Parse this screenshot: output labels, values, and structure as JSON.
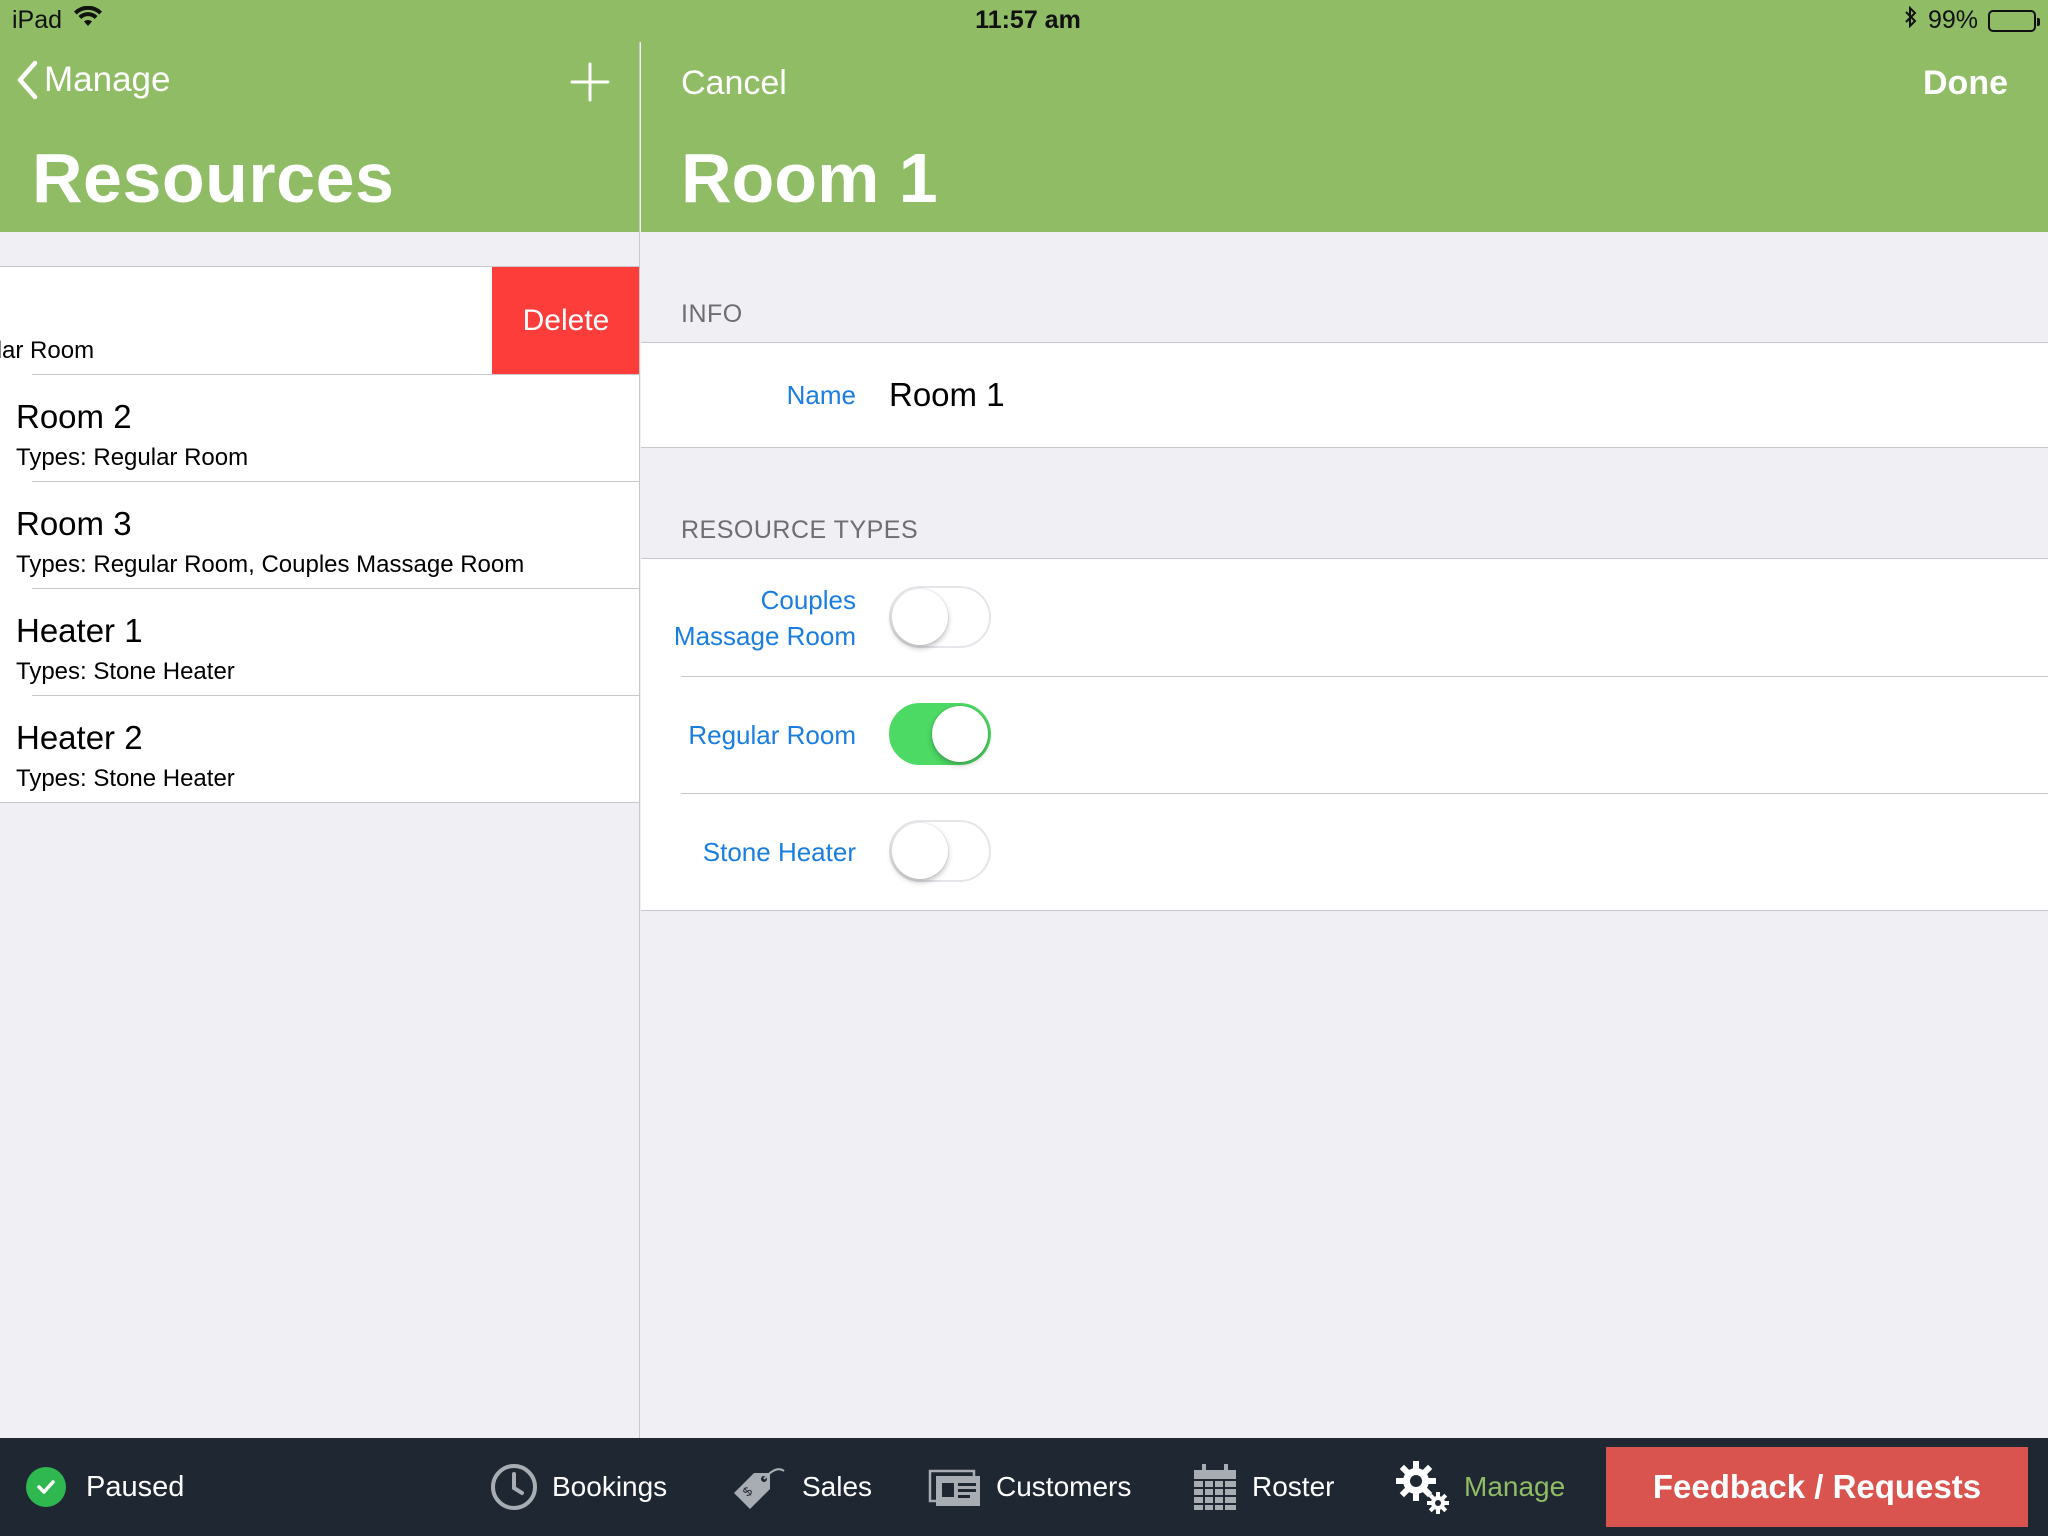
{
  "status_bar": {
    "device": "iPad",
    "time": "11:57 am",
    "battery_text": "99%",
    "battery_level": 0.99
  },
  "master": {
    "back_label": "Manage",
    "title": "Resources",
    "delete_label": "Delete",
    "rows": [
      {
        "title": "",
        "subtitle": "gular Room"
      },
      {
        "title": "Room 2",
        "subtitle": "Types: Regular Room"
      },
      {
        "title": "Room 3",
        "subtitle": "Types: Regular Room, Couples Massage Room"
      },
      {
        "title": "Heater 1",
        "subtitle": "Types: Stone Heater"
      },
      {
        "title": "Heater 2",
        "subtitle": "Types: Stone Heater"
      }
    ]
  },
  "detail": {
    "cancel_label": "Cancel",
    "done_label": "Done",
    "title": "Room 1",
    "info_header": "INFO",
    "name_label": "Name",
    "name_value": "Room 1",
    "types_header": "RESOURCE TYPES",
    "types": [
      {
        "label_line1": "Couples",
        "label_line2": "Massage Room",
        "on": false
      },
      {
        "label": "Regular Room",
        "on": true
      },
      {
        "label": "Stone Heater",
        "on": false
      }
    ]
  },
  "tabbar": {
    "status_label": "Paused",
    "tabs": [
      {
        "label": "Bookings",
        "icon": "clock-icon"
      },
      {
        "label": "Sales",
        "icon": "price-tag-icon"
      },
      {
        "label": "Customers",
        "icon": "customers-cards-icon"
      },
      {
        "label": "Roster",
        "icon": "calendar-icon"
      },
      {
        "label": "Manage",
        "icon": "gears-icon",
        "active": true
      }
    ],
    "feedback_label": "Feedback / Requests"
  },
  "colors": {
    "nav_green": "#8fbc64",
    "link_blue": "#1a7ee0",
    "delete_red": "#fc3d39",
    "switch_green": "#4cd964",
    "tabbar_bg": "#1f2732",
    "feedback_red": "#d9534f"
  }
}
